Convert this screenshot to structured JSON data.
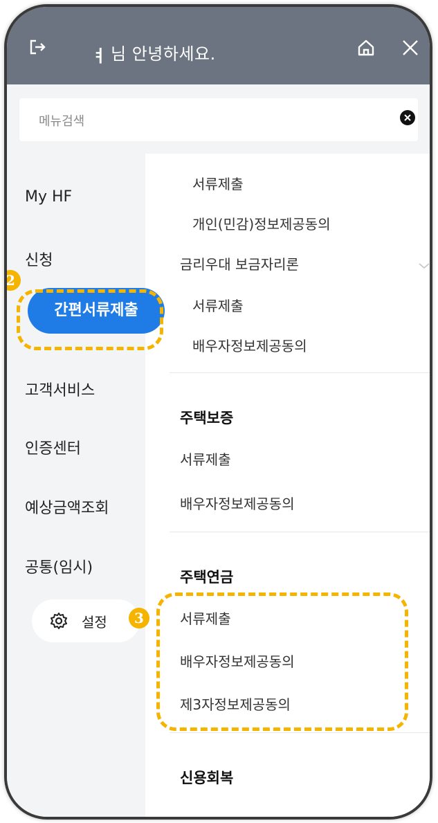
{
  "header": {
    "greeting": "님 안녕하세요.",
    "name_mark": "ㅕ"
  },
  "search": {
    "placeholder": "메뉴검색"
  },
  "left_nav": {
    "items": [
      "My HF",
      "신청",
      "간편서류제출",
      "고객서비스",
      "인증센터",
      "예상금액조회",
      "공통(임시)"
    ],
    "active": "간편서류제출",
    "settings_label": "설정"
  },
  "content": {
    "top_items": [
      "서류제출",
      "개인(민감)정보제공동의"
    ],
    "group1": {
      "title": "금리우대 보금자리론",
      "items": [
        "서류제출",
        "배우자정보제공동의"
      ]
    },
    "section1": {
      "title": "주택보증",
      "items": [
        "서류제출",
        "배우자정보제공동의"
      ]
    },
    "section2": {
      "title": "주택연금",
      "items": [
        "서류제출",
        "배우자정보제공동의",
        "제3자정보제공동의"
      ]
    },
    "section3": {
      "title": "신용회복"
    }
  },
  "annotations": {
    "badge2": "2",
    "badge3": "3",
    "color": "#f5b400"
  },
  "colors": {
    "header_bg": "#6b7480",
    "active_bg": "#1f7be6",
    "panel_bg": "#f3f4f6"
  }
}
